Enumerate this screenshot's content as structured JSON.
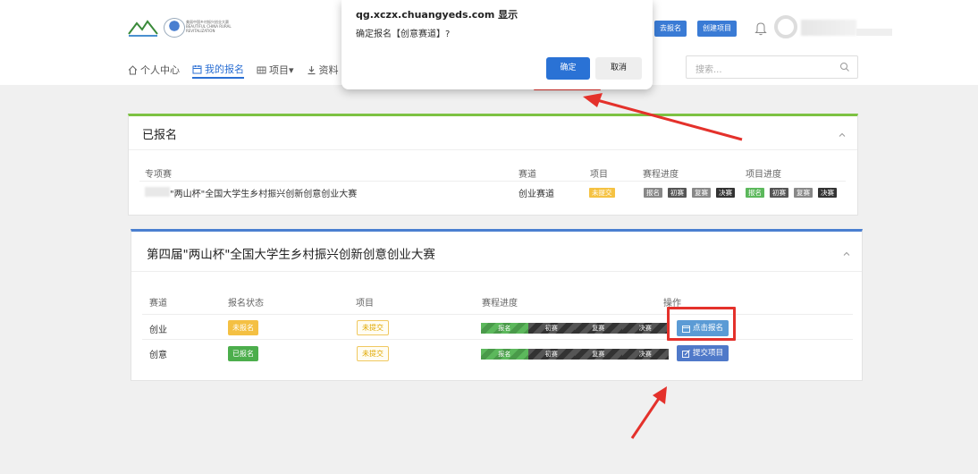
{
  "header": {
    "logo_text": "美丽中国乡村振兴创业大赛 BEAUTIFUL CHINA RURAL REVITALIZATION",
    "register_btn": "去报名",
    "create_project_btn": "创建项目"
  },
  "nav": {
    "items": [
      {
        "label": "个人中心"
      },
      {
        "label": "我的报名"
      },
      {
        "label": "项目▾"
      },
      {
        "label": "资料"
      }
    ]
  },
  "search": {
    "placeholder": "搜索..."
  },
  "dialog": {
    "origin": "qg.xczx.chuangyeds.com 显示",
    "message": "确定报名【创意赛道】?",
    "ok": "确定",
    "cancel": "取消"
  },
  "registered": {
    "title": "已报名",
    "headers": [
      "专项赛",
      "赛道",
      "项目",
      "赛程进度",
      "项目进度"
    ],
    "row": {
      "competition": "\"两山杯\"全国大学生乡村振兴创新创意创业大赛",
      "track": "创业赛道",
      "project": "未提交",
      "race_stages": [
        "报名",
        "初赛",
        "复赛",
        "决赛"
      ],
      "project_stages": [
        "报名",
        "初赛",
        "复赛",
        "决赛"
      ]
    }
  },
  "competition": {
    "title": "第四届\"两山杯\"全国大学生乡村振兴创新创意创业大赛",
    "headers": [
      "赛道",
      "报名状态",
      "项目",
      "赛程进度",
      "操作"
    ],
    "rows": [
      {
        "track": "创业",
        "status": "未报名",
        "project": "未提交",
        "stages": [
          "报名",
          "初赛",
          "复赛",
          "决赛"
        ],
        "action": "点击报名"
      },
      {
        "track": "创意",
        "status": "已报名",
        "project": "未提交",
        "stages": [
          "报名",
          "初赛",
          "复赛",
          "决赛"
        ],
        "action": "提交项目"
      }
    ]
  },
  "colors": {
    "primary": "#2a72d5",
    "green_accent": "#7dc242",
    "blue_accent": "#4a7fd0",
    "highlight_red": "#e4312b"
  }
}
